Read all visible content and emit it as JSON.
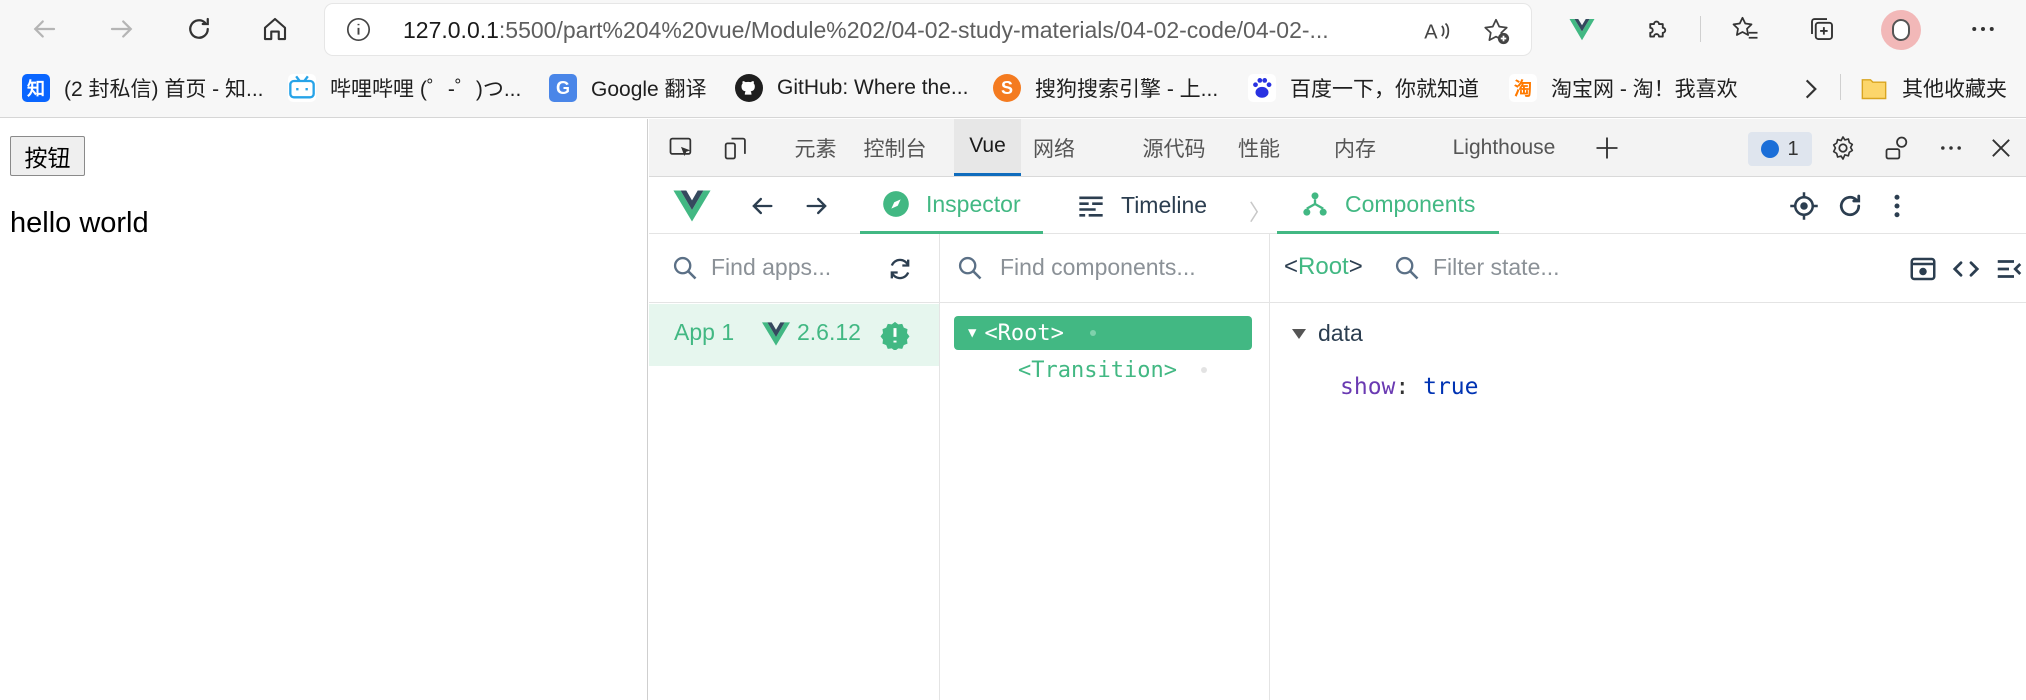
{
  "browser": {
    "address_host": "127.0.0.1",
    "address_rest": ":5500/part%204%20vue/Module%202/04-02-study-materials/04-02-code/04-02-..."
  },
  "bookmarks": [
    {
      "label": "(2 封私信) 首页 - 知...",
      "icon": "zhihu-icon",
      "icon_text": "知",
      "color": "#0a66ff"
    },
    {
      "label": "哔哩哔哩 (゜-゜)つ...",
      "icon": "bilibili-icon",
      "icon_text": "",
      "color": "#26a3e8"
    },
    {
      "label": "Google 翻译",
      "icon": "google-translate-icon",
      "icon_text": "G",
      "color": "#4a86e8"
    },
    {
      "label": "GitHub: Where the...",
      "icon": "github-icon",
      "icon_text": "",
      "color": "#1f1f1f"
    },
    {
      "label": "搜狗搜索引擎 - 上...",
      "icon": "sogou-icon",
      "icon_text": "S",
      "color": "#f47b20"
    },
    {
      "label": "百度一下，你就知道",
      "icon": "baidu-icon",
      "icon_text": "",
      "color": "#2932e1"
    },
    {
      "label": "淘宝网 - 淘！我喜欢",
      "icon": "taobao-icon",
      "icon_text": "淘",
      "color": "#ff7a00"
    }
  ],
  "bookmarks_other": "其他收藏夹",
  "page": {
    "button_label": "按钮",
    "text": "hello world"
  },
  "devtools": {
    "tabs": [
      "元素",
      "控制台",
      "Vue",
      "网络",
      "源代码",
      "性能",
      "内存",
      "Lighthouse"
    ],
    "active_tab": "Vue",
    "issues_count": "1"
  },
  "vue": {
    "tabs": {
      "inspector": "Inspector",
      "timeline": "Timeline",
      "components": "Components"
    },
    "apps_search_placeholder": "Find apps...",
    "components_search_placeholder": "Find components...",
    "state_filter_placeholder": "Filter state...",
    "app": {
      "name": "App 1",
      "version": "2.6.12"
    },
    "tree": {
      "root": "<Root>",
      "child": "<Transition>"
    },
    "state": {
      "selected": "Root",
      "section": "data",
      "prop_key": "show",
      "prop_value": "true"
    }
  },
  "colors": {
    "vue_green": "#42b883",
    "vue_dark": "#35495e"
  }
}
